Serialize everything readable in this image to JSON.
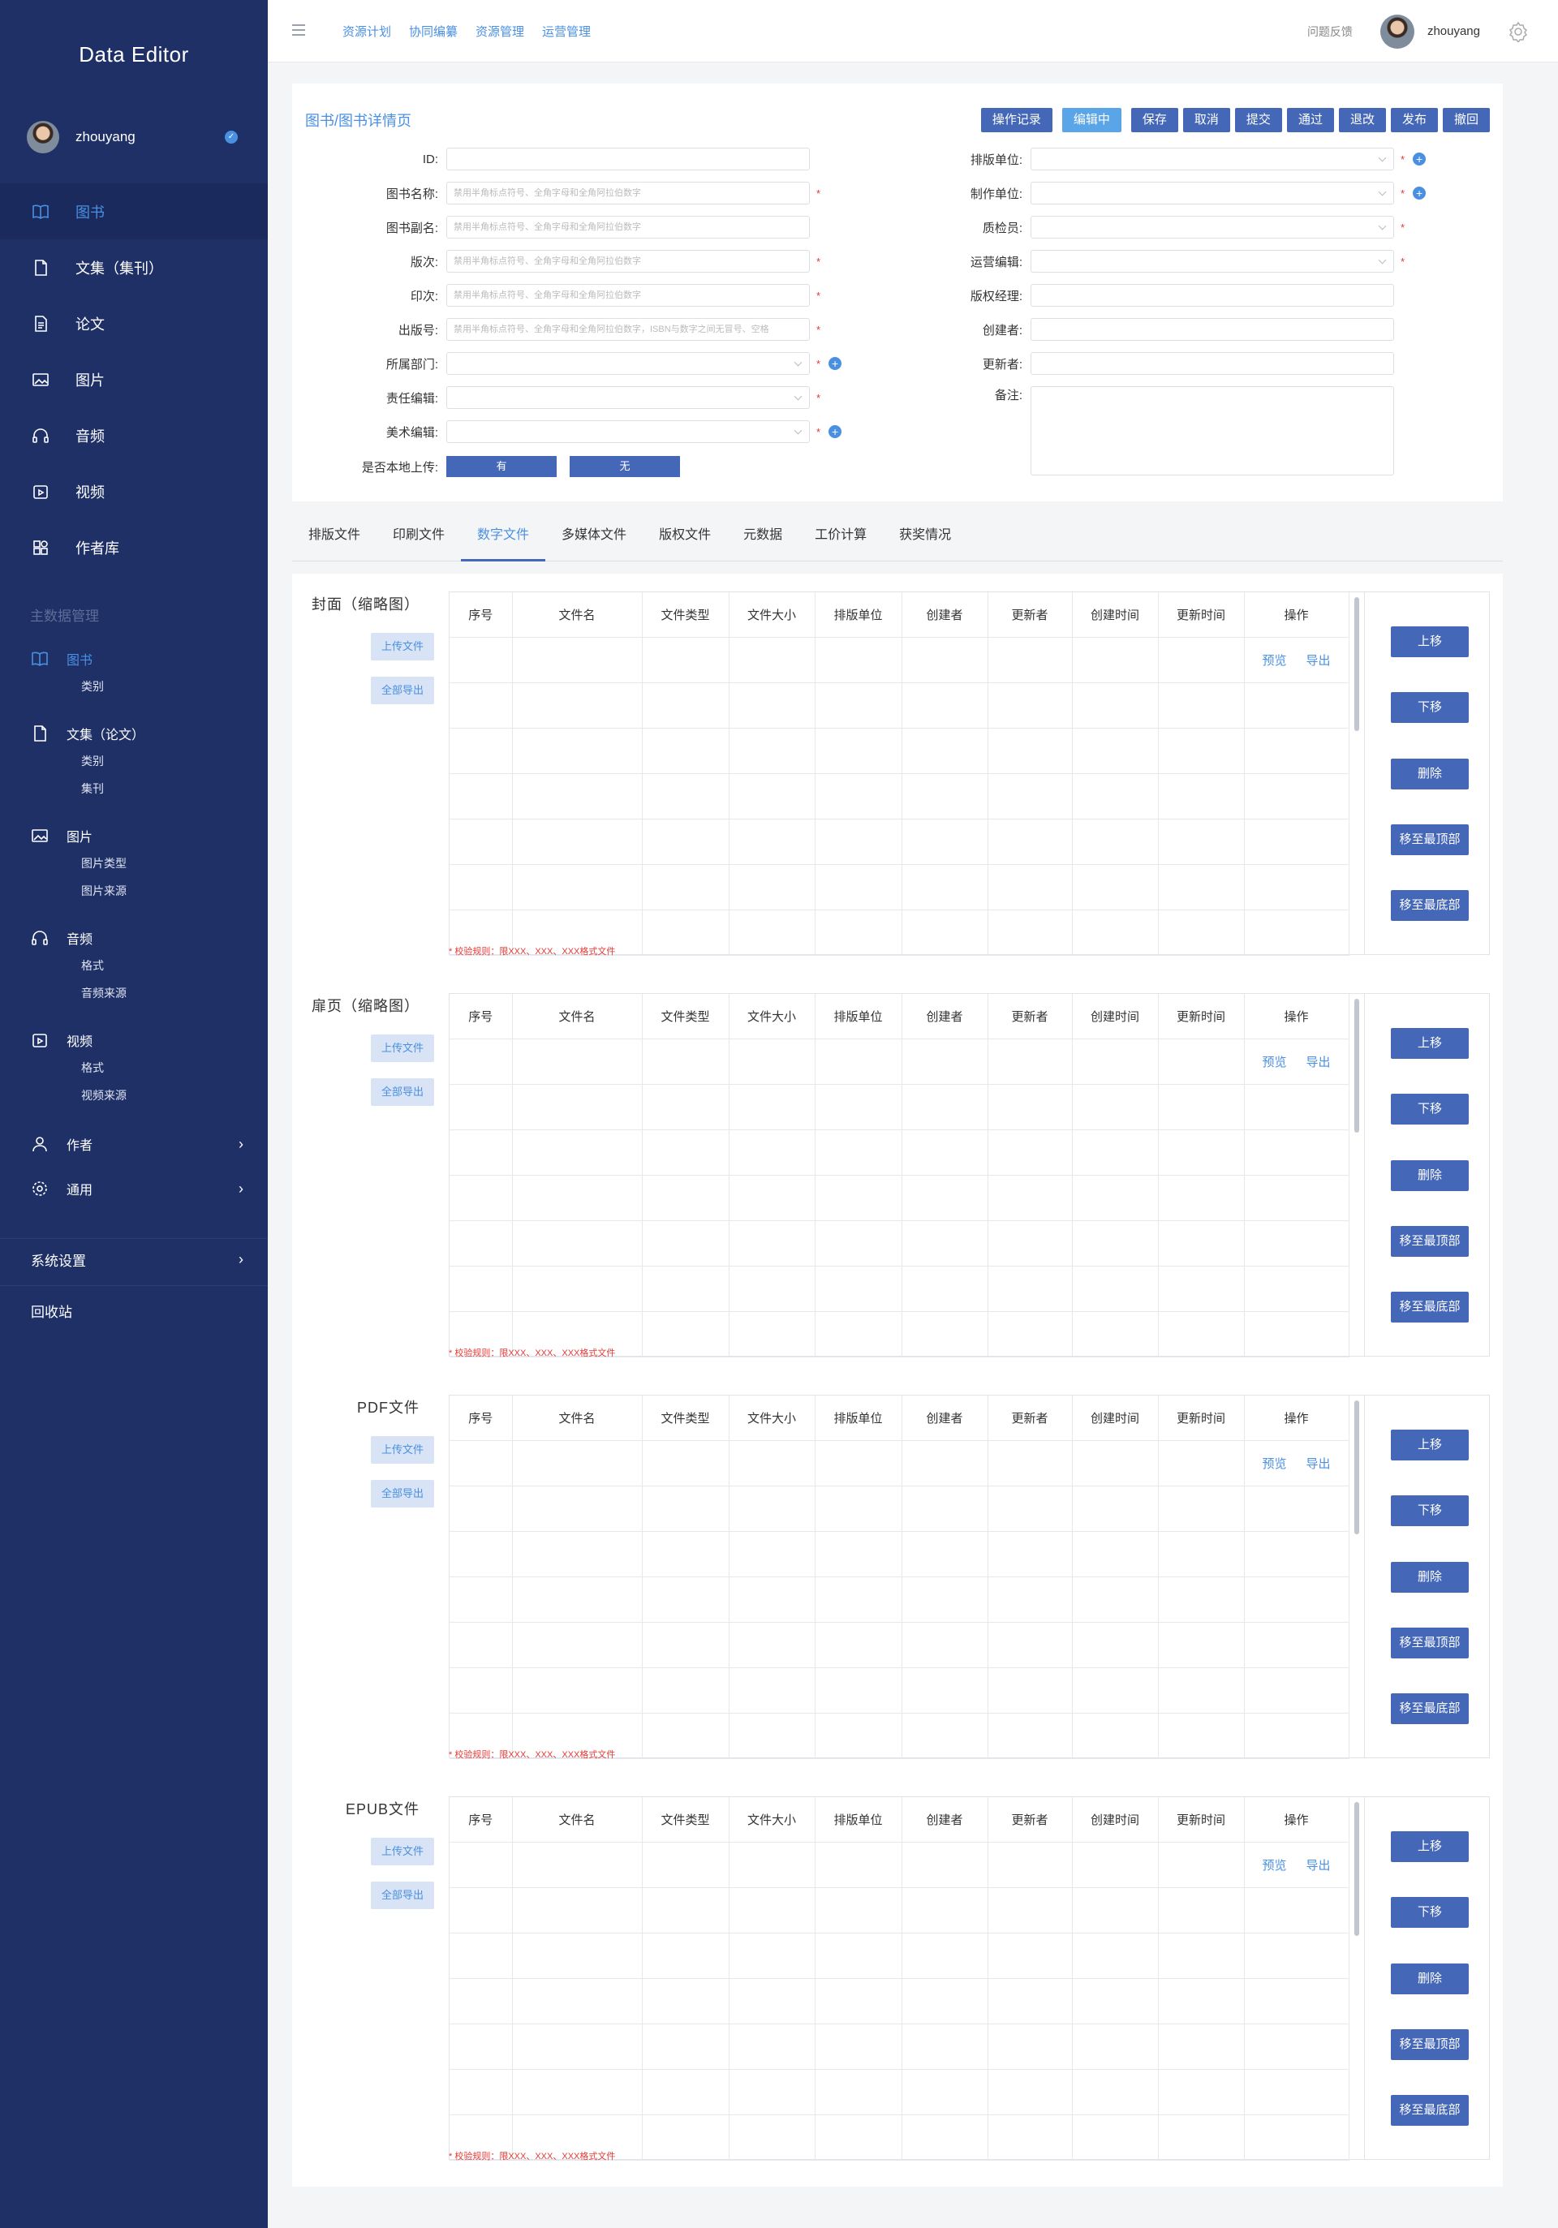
{
  "app": {
    "title": "Data Editor"
  },
  "user": {
    "name": "zhouyang"
  },
  "sidebar": {
    "nav": [
      {
        "label": "图书",
        "icon": "book-icon",
        "active": true
      },
      {
        "label": "文集（集刊）",
        "icon": "document-icon"
      },
      {
        "label": "论文",
        "icon": "paper-icon"
      },
      {
        "label": "图片",
        "icon": "image-icon"
      },
      {
        "label": "音频",
        "icon": "headphones-icon"
      },
      {
        "label": "视频",
        "icon": "video-icon"
      },
      {
        "label": "作者库",
        "icon": "grid-icon"
      }
    ],
    "section_title": "主数据管理",
    "master": [
      {
        "label": "图书",
        "icon": "book-icon",
        "active": true,
        "subs": [
          "类别"
        ]
      },
      {
        "label": "文集（论文）",
        "icon": "document-icon",
        "subs": [
          "类别",
          "集刊"
        ]
      },
      {
        "label": "图片",
        "icon": "image-icon",
        "subs": [
          "图片类型",
          "图片来源"
        ]
      },
      {
        "label": "音频",
        "icon": "headphones-icon",
        "subs": [
          "格式",
          "音频来源"
        ]
      },
      {
        "label": "视频",
        "icon": "video-icon",
        "subs": [
          "格式",
          "视频来源"
        ]
      }
    ],
    "author": "作者",
    "general": "通用",
    "system": "系统设置",
    "recycle": "回收站"
  },
  "topbar": {
    "nav": [
      "资源计划",
      "协同编纂",
      "资源管理",
      "运营管理"
    ],
    "feedback": "问题反馈"
  },
  "detail": {
    "breadcrumb": "图书/图书详情页",
    "actions": [
      "操作记录",
      "编辑中",
      "保存",
      "取消",
      "提交",
      "通过",
      "退改",
      "发布",
      "撤回"
    ],
    "left_fields": [
      {
        "label": "ID:",
        "placeholder": ""
      },
      {
        "label": "图书名称:",
        "placeholder": "禁用半角标点符号、全角字母和全角阿拉伯数字"
      },
      {
        "label": "图书副名:",
        "placeholder": "禁用半角标点符号、全角字母和全角阿拉伯数字"
      },
      {
        "label": "版次:",
        "placeholder": "禁用半角标点符号、全角字母和全角阿拉伯数字"
      },
      {
        "label": "印次:",
        "placeholder": "禁用半角标点符号、全角字母和全角阿拉伯数字"
      },
      {
        "label": "出版号:",
        "placeholder": "禁用半角标点符号、全角字母和全角阿拉伯数字，ISBN与数字之间无冒号、空格"
      },
      {
        "label": "所属部门:",
        "placeholder": ""
      },
      {
        "label": "责任编辑:",
        "placeholder": ""
      },
      {
        "label": "美术编辑:",
        "placeholder": ""
      }
    ],
    "upload_label": "是否本地上传:",
    "upload_options": [
      "有",
      "无"
    ],
    "right_fields": [
      {
        "label": "排版单位:"
      },
      {
        "label": "制作单位:"
      },
      {
        "label": "质检员:"
      },
      {
        "label": "运营编辑:"
      },
      {
        "label": "版权经理:"
      },
      {
        "label": "创建者:"
      },
      {
        "label": "更新者:"
      },
      {
        "label": "备注:"
      }
    ]
  },
  "tabs": [
    "排版文件",
    "印刷文件",
    "数字文件",
    "多媒体文件",
    "版权文件",
    "元数据",
    "工价计算",
    "获奖情况"
  ],
  "files": {
    "upload_label": "上传文件",
    "export_all_label": "全部导出",
    "columns": [
      "序号",
      "文件名",
      "文件类型",
      "文件大小",
      "排版单位",
      "创建者",
      "更新者",
      "创建时间",
      "更新时间",
      "操作"
    ],
    "row_actions": [
      "预览",
      "导出"
    ],
    "op_buttons": [
      "上移",
      "下移",
      "删除",
      "移至最顶部",
      "移至最底部"
    ],
    "rule": "* 校验规则：限XXX、XXX、XXX格式文件",
    "sections": [
      {
        "title": "封面（缩略图）"
      },
      {
        "title": "扉页（缩略图）"
      },
      {
        "title": "PDF文件"
      },
      {
        "title": "EPUB文件"
      }
    ]
  },
  "colors": {
    "sidebar": "#1f3066",
    "accent": "#4a90e2",
    "button": "#4467b7",
    "required": "#e53935"
  }
}
